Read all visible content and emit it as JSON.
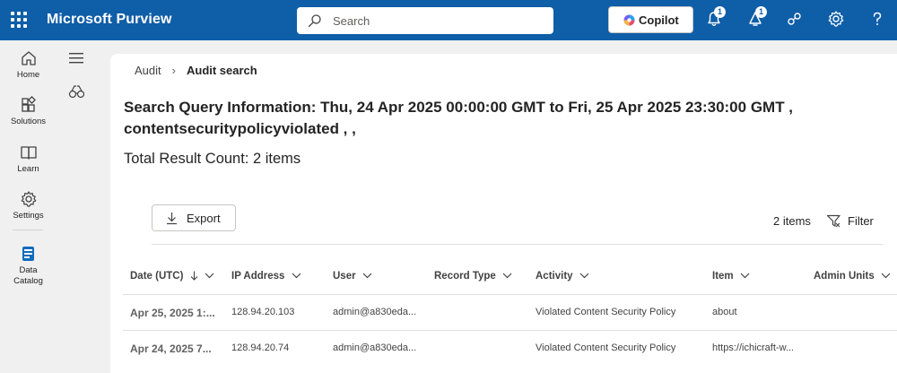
{
  "app": {
    "title": "Microsoft Purview"
  },
  "search": {
    "placeholder": "Search"
  },
  "copilot": {
    "label": "Copilot"
  },
  "header_icons": [
    {
      "name": "notifications-icon",
      "badge": "1"
    },
    {
      "name": "alerts-icon",
      "badge": "1"
    },
    {
      "name": "connections-icon"
    },
    {
      "name": "settings-icon"
    },
    {
      "name": "help-icon"
    }
  ],
  "rail": {
    "items": [
      {
        "label": "Home",
        "icon": "home-icon"
      },
      {
        "label": "Solutions",
        "icon": "solutions-icon"
      },
      {
        "label": "Learn",
        "icon": "learn-icon"
      },
      {
        "label": "Settings",
        "icon": "settings-icon"
      },
      {
        "label": "Data Catalog",
        "icon": "data-catalog-icon"
      }
    ]
  },
  "breadcrumb": {
    "parent": "Audit",
    "current": "Audit search"
  },
  "query": {
    "info": "Search Query Information: Thu, 24 Apr 2025 00:00:00 GMT to Fri, 25 Apr 2025 23:30:00 GMT , contentsecuritypolicyviolated , ,",
    "total": "Total Result Count: 2 items"
  },
  "toolbar": {
    "export_label": "Export",
    "count": "2 items",
    "filter_label": "Filter"
  },
  "table": {
    "columns": [
      "Date (UTC)",
      "IP Address",
      "User",
      "Record Type",
      "Activity",
      "Item",
      "Admin Units"
    ],
    "rows": [
      [
        "Apr 25, 2025 1:...",
        "128.94.20.103",
        "admin@a830eda...",
        "",
        "Violated Content Security Policy",
        "about",
        ""
      ],
      [
        "Apr 24, 2025 7...",
        "128.94.20.74",
        "admin@a830eda...",
        "",
        "Violated Content Security Policy",
        "https://ichicraft-w...",
        ""
      ]
    ]
  },
  "colors": {
    "header": "#0f5ea8",
    "accent": "#0f6cbd"
  }
}
